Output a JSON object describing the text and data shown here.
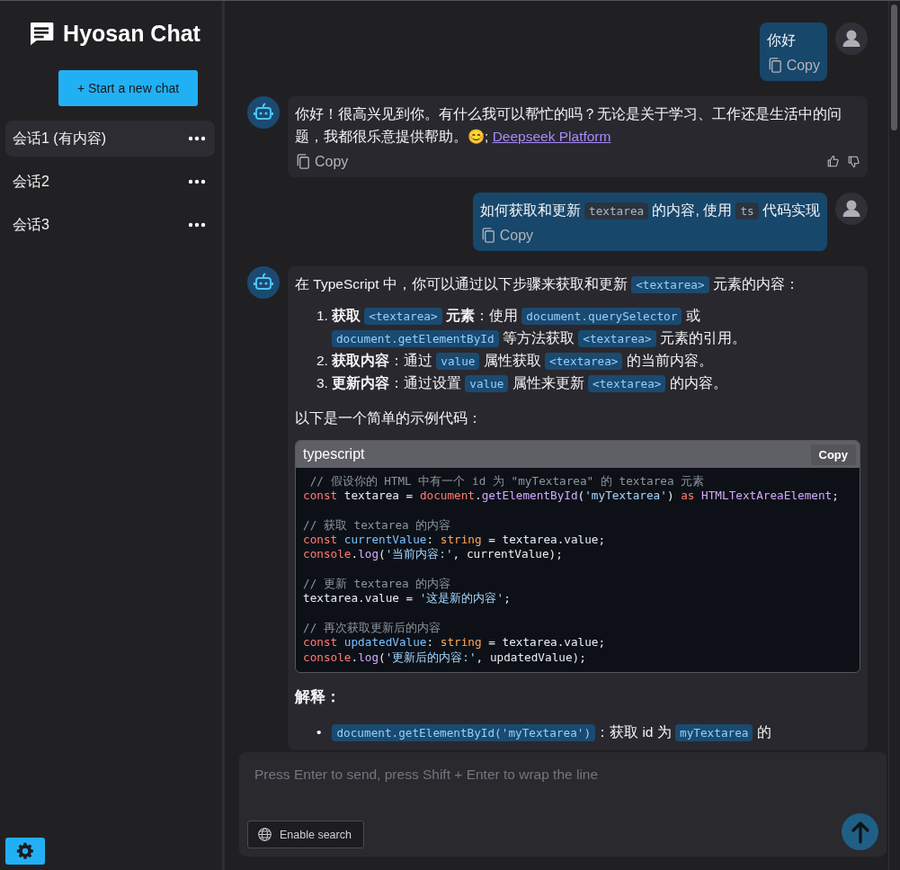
{
  "sidebar": {
    "app_title": "Hyosan Chat",
    "new_chat_button": "+ Start a new chat",
    "conversations": [
      {
        "title": "会话1 (有内容)",
        "selected": true
      },
      {
        "title": "会话2",
        "selected": false
      },
      {
        "title": "会话3",
        "selected": false
      }
    ]
  },
  "messages": [
    {
      "kind": "user",
      "blocks": [
        {
          "kind": "paragraph",
          "segments": [
            {
              "kind": "text",
              "text": "你好"
            }
          ]
        }
      ],
      "copy_label": "Copy"
    },
    {
      "kind": "assistant",
      "blocks": [
        {
          "kind": "paragraph",
          "segments": [
            {
              "kind": "text",
              "text": "你好！很高兴见到你。有什么我可以帮忙的吗？无论是关于学习、工作还是生活中的问题，我都很乐意提供帮助。😊; "
            },
            {
              "kind": "link",
              "text": "Deepseek Platform"
            }
          ]
        }
      ],
      "copy_label": "Copy"
    },
    {
      "kind": "user",
      "blocks": [
        {
          "kind": "paragraph",
          "segments": [
            {
              "kind": "text",
              "text": "如何获取和更新 "
            },
            {
              "kind": "code",
              "text": "textarea"
            },
            {
              "kind": "text",
              "text": " 的内容, 使用 "
            },
            {
              "kind": "code",
              "text": "ts"
            },
            {
              "kind": "text",
              "text": " 代码实现"
            }
          ]
        }
      ],
      "copy_label": "Copy"
    },
    {
      "kind": "assistant",
      "blocks": [
        {
          "kind": "paragraph",
          "segments": [
            {
              "kind": "text",
              "text": "在 TypeScript 中，你可以通过以下步骤来获取和更新 "
            },
            {
              "kind": "code",
              "text": "<textarea>"
            },
            {
              "kind": "text",
              "text": " 元素的内容："
            }
          ]
        },
        {
          "kind": "list",
          "items": [
            {
              "marker": "1.",
              "segments": [
                {
                  "kind": "bold",
                  "text": "获取 "
                },
                {
                  "kind": "code",
                  "text": "<textarea>"
                },
                {
                  "kind": "bold",
                  "text": " 元素"
                },
                {
                  "kind": "text",
                  "text": "：使用 "
                },
                {
                  "kind": "code",
                  "text": "document.querySelector"
                },
                {
                  "kind": "text",
                  "text": " 或 "
                },
                {
                  "kind": "code",
                  "text": "document.getElementById"
                },
                {
                  "kind": "text",
                  "text": " 等方法获取 "
                },
                {
                  "kind": "code",
                  "text": "<textarea>"
                },
                {
                  "kind": "text",
                  "text": " 元素的引用。"
                }
              ]
            },
            {
              "marker": "2.",
              "segments": [
                {
                  "kind": "bold",
                  "text": "获取内容"
                },
                {
                  "kind": "text",
                  "text": "：通过 "
                },
                {
                  "kind": "code",
                  "text": "value"
                },
                {
                  "kind": "text",
                  "text": " 属性获取 "
                },
                {
                  "kind": "code",
                  "text": "<textarea>"
                },
                {
                  "kind": "text",
                  "text": " 的当前内容。"
                }
              ]
            },
            {
              "marker": "3.",
              "segments": [
                {
                  "kind": "bold",
                  "text": "更新内容"
                },
                {
                  "kind": "text",
                  "text": "：通过设置 "
                },
                {
                  "kind": "code",
                  "text": "value"
                },
                {
                  "kind": "text",
                  "text": " 属性来更新 "
                },
                {
                  "kind": "code",
                  "text": "<textarea>"
                },
                {
                  "kind": "text",
                  "text": " 的内容。"
                }
              ]
            }
          ]
        },
        {
          "kind": "paragraph",
          "segments": [
            {
              "kind": "text",
              "text": "以下是一个简单的示例代码："
            }
          ]
        },
        {
          "kind": "code_block",
          "language": "typescript",
          "copy_label": "Copy",
          "lines": [
            {
              "kind": "code",
              "tokens": [
                {
                  "kind": "comment",
                  "text": " // 假设你的 HTML 中有一个 id 为 \"myTextarea\" 的 textarea 元素"
                }
              ]
            },
            {
              "kind": "code",
              "tokens": [
                {
                  "kind": "keyword",
                  "text": "const"
                },
                {
                  "kind": "plain",
                  "text": " textarea = "
                },
                {
                  "kind": "keyword",
                  "text": "document"
                },
                {
                  "kind": "plain",
                  "text": "."
                },
                {
                  "kind": "function",
                  "text": "getElementById"
                },
                {
                  "kind": "plain",
                  "text": "("
                },
                {
                  "kind": "string",
                  "text": "'myTextarea'"
                },
                {
                  "kind": "plain",
                  "text": ") "
                },
                {
                  "kind": "keyword",
                  "text": "as"
                },
                {
                  "kind": "function",
                  "text": " HTMLTextAreaElement"
                },
                {
                  "kind": "plain",
                  "text": ";"
                }
              ]
            },
            {
              "kind": "blank"
            },
            {
              "kind": "code",
              "tokens": [
                {
                  "kind": "comment",
                  "text": "// 获取 textarea 的内容"
                }
              ]
            },
            {
              "kind": "code",
              "tokens": [
                {
                  "kind": "keyword",
                  "text": "const"
                },
                {
                  "kind": "variable",
                  "text": " currentValue"
                },
                {
                  "kind": "plain",
                  "text": ": "
                },
                {
                  "kind": "type",
                  "text": "string"
                },
                {
                  "kind": "plain",
                  "text": " = textarea.value;"
                }
              ]
            },
            {
              "kind": "code",
              "tokens": [
                {
                  "kind": "keyword",
                  "text": "console"
                },
                {
                  "kind": "plain",
                  "text": "."
                },
                {
                  "kind": "function",
                  "text": "log"
                },
                {
                  "kind": "plain",
                  "text": "("
                },
                {
                  "kind": "string",
                  "text": "'当前内容:'"
                },
                {
                  "kind": "plain",
                  "text": ", currentValue);"
                }
              ]
            },
            {
              "kind": "blank"
            },
            {
              "kind": "code",
              "tokens": [
                {
                  "kind": "comment",
                  "text": "// 更新 textarea 的内容"
                }
              ]
            },
            {
              "kind": "code",
              "tokens": [
                {
                  "kind": "plain",
                  "text": "textarea.value = "
                },
                {
                  "kind": "string",
                  "text": "'这是新的内容'"
                },
                {
                  "kind": "plain",
                  "text": ";"
                }
              ]
            },
            {
              "kind": "blank"
            },
            {
              "kind": "code",
              "tokens": [
                {
                  "kind": "comment",
                  "text": "// 再次获取更新后的内容"
                }
              ]
            },
            {
              "kind": "code",
              "tokens": [
                {
                  "kind": "keyword",
                  "text": "const"
                },
                {
                  "kind": "variable",
                  "text": " updatedValue"
                },
                {
                  "kind": "plain",
                  "text": ": "
                },
                {
                  "kind": "type",
                  "text": "string"
                },
                {
                  "kind": "plain",
                  "text": " = textarea.value;"
                }
              ]
            },
            {
              "kind": "code",
              "tokens": [
                {
                  "kind": "keyword",
                  "text": "console"
                },
                {
                  "kind": "plain",
                  "text": "."
                },
                {
                  "kind": "function",
                  "text": "log"
                },
                {
                  "kind": "plain",
                  "text": "("
                },
                {
                  "kind": "string",
                  "text": "'更新后的内容:'"
                },
                {
                  "kind": "plain",
                  "text": ", updatedValue);"
                }
              ]
            }
          ]
        },
        {
          "kind": "heading",
          "text": "解释："
        },
        {
          "kind": "bullets",
          "items": [
            {
              "marker": "•",
              "segments": [
                {
                  "kind": "code",
                  "text": "document.getElementById('myTextarea')"
                },
                {
                  "kind": "text",
                  "text": "：获取 id 为 "
                },
                {
                  "kind": "code",
                  "text": "myTextarea"
                },
                {
                  "kind": "text",
                  "text": " 的"
                }
              ]
            }
          ]
        }
      ]
    }
  ],
  "composer": {
    "placeholder": "Press Enter to send, press Shift + Enter to wrap the line",
    "search_button": "Enable search"
  }
}
